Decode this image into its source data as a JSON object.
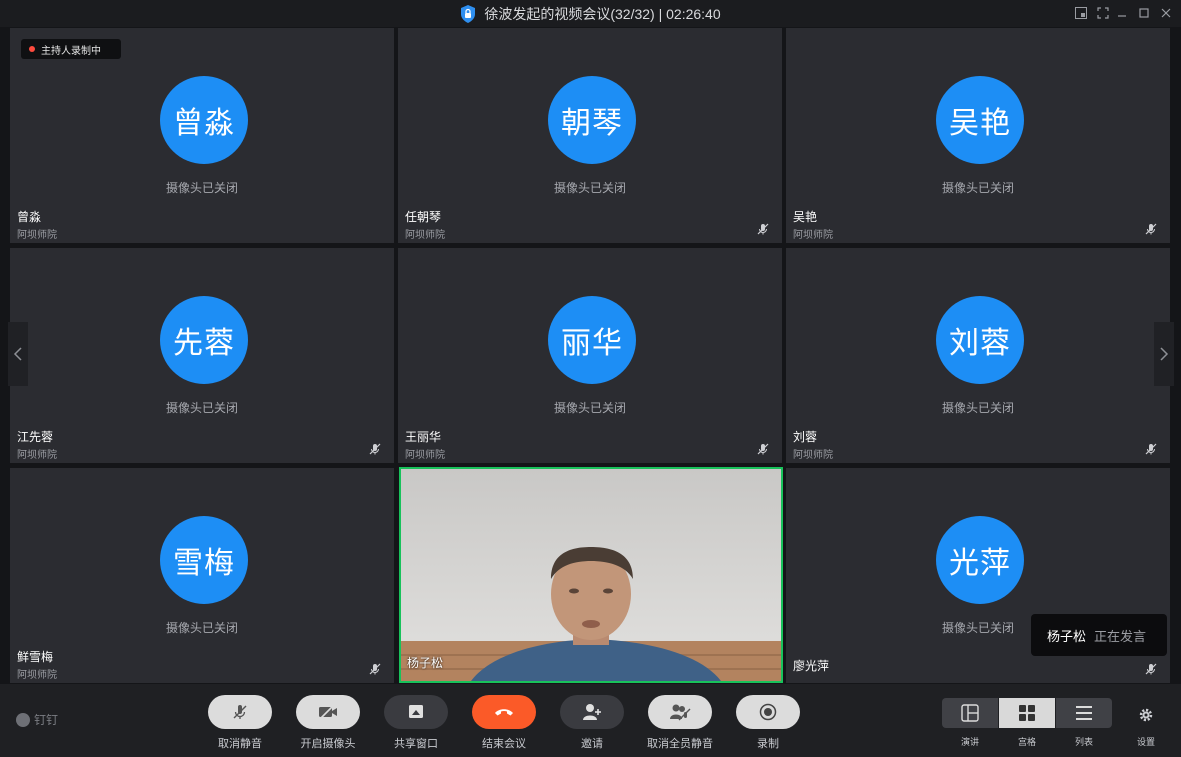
{
  "window": {
    "title": "徐波发起的视频会议(32/32) | 02:26:40"
  },
  "recording_badge": "主持人录制中",
  "camera_off_text": "摄像头已关闭",
  "participants": [
    {
      "avatar": "曾淼",
      "name": "曾淼",
      "org": "阿坝师院",
      "muted": false
    },
    {
      "avatar": "朝琴",
      "name": "任朝琴",
      "org": "阿坝师院",
      "muted": true
    },
    {
      "avatar": "吴艳",
      "name": "吴艳",
      "org": "阿坝师院",
      "muted": true
    },
    {
      "avatar": "先蓉",
      "name": "江先蓉",
      "org": "阿坝师院",
      "muted": true
    },
    {
      "avatar": "丽华",
      "name": "王丽华",
      "org": "阿坝师院",
      "muted": true
    },
    {
      "avatar": "刘蓉",
      "name": "刘蓉",
      "org": "阿坝师院",
      "muted": true
    },
    {
      "avatar": "雪梅",
      "name": "鲜雪梅",
      "org": "阿坝师院",
      "muted": true
    },
    {
      "avatar": "",
      "name": "杨子松",
      "org": "",
      "muted": false,
      "video": true
    },
    {
      "avatar": "光萍",
      "name": "廖光萍",
      "org": "",
      "muted": true
    }
  ],
  "speaking_toast": {
    "name": "杨子松",
    "status": "正在发言"
  },
  "toolbar": {
    "brand": "钉钉",
    "buttons": [
      {
        "label": "取消静音",
        "icon": "mic-muted-icon"
      },
      {
        "label": "开启摄像头",
        "icon": "camera-off-icon"
      },
      {
        "label": "共享窗口",
        "icon": "share-screen-icon"
      },
      {
        "label": "结束会议",
        "icon": "hang-up-icon"
      },
      {
        "label": "邀请",
        "icon": "add-user-icon"
      },
      {
        "label": "取消全员静音",
        "icon": "mute-all-icon"
      },
      {
        "label": "录制",
        "icon": "record-icon"
      }
    ],
    "layout_modes": [
      {
        "label": "演讲",
        "icon": "speaker-layout-icon",
        "active": false
      },
      {
        "label": "宫格",
        "icon": "grid-layout-icon",
        "active": true
      },
      {
        "label": "列表",
        "icon": "list-layout-icon",
        "active": false
      }
    ],
    "settings_label": "设置"
  },
  "colors": {
    "avatar": "#1d8ef5",
    "active_speaker_border": "#18c25b",
    "end_call": "#fb5a28",
    "recording_dot": "#ff4b3e"
  }
}
